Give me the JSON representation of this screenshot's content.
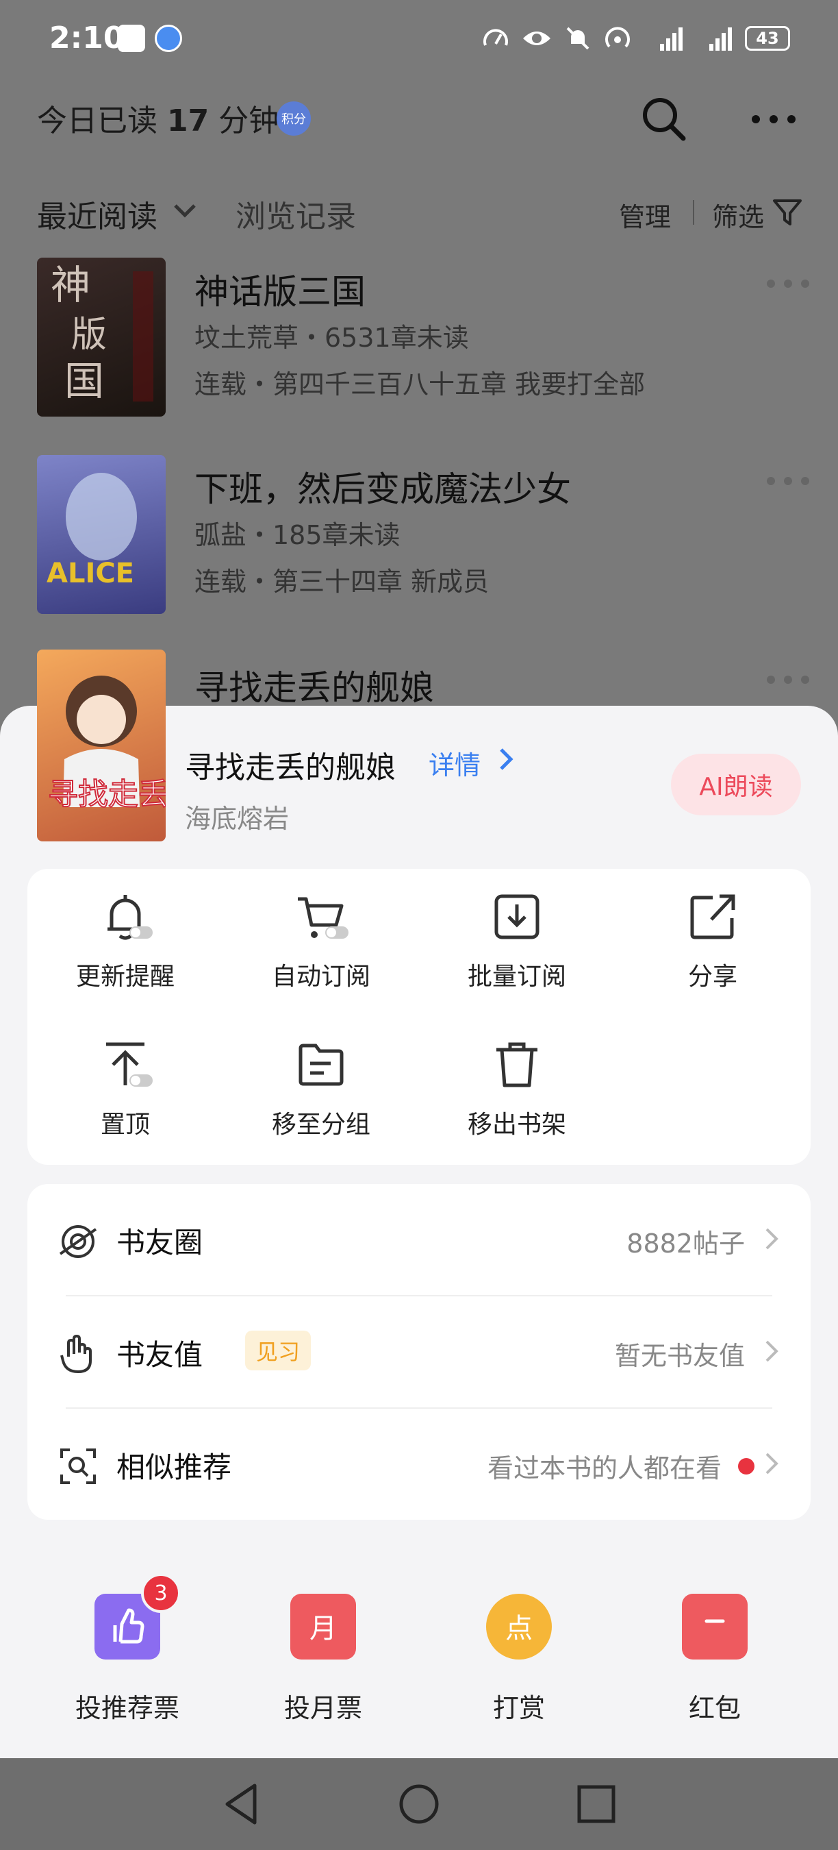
{
  "status_bar": {
    "time": "2:10",
    "battery": "43"
  },
  "header": {
    "today_read_prefix": "今日已读",
    "today_read_minutes": "17",
    "today_read_suffix": "分钟",
    "points_badge": "积分"
  },
  "tabs": {
    "recent": "最近阅读",
    "history": "浏览记录",
    "manage": "管理",
    "filter": "筛选"
  },
  "books": [
    {
      "title": "神话版三国",
      "meta": "坟土荒草・6531章未读",
      "latest": "连载・第四千三百八十五章 我要打全部"
    },
    {
      "title": "下班，然后变成魔法少女",
      "meta": "弧盐・185章未读",
      "latest": "连载・第三十四章 新成员"
    },
    {
      "title": "寻找走丢的舰娘"
    }
  ],
  "sheet": {
    "title": "寻找走丢的舰娘",
    "detail": "详情",
    "author": "海底熔岩",
    "ai_read": "AI朗读",
    "actions": [
      {
        "label": "更新提醒",
        "icon": "bell-toggle-icon"
      },
      {
        "label": "自动订阅",
        "icon": "cart-toggle-icon"
      },
      {
        "label": "批量订阅",
        "icon": "download-icon"
      },
      {
        "label": "分享",
        "icon": "share-icon"
      },
      {
        "label": "置顶",
        "icon": "pin-top-icon"
      },
      {
        "label": "移至分组",
        "icon": "folder-icon"
      },
      {
        "label": "移出书架",
        "icon": "trash-icon"
      }
    ],
    "info": {
      "circle": {
        "label": "书友圈",
        "value": "8882帖子"
      },
      "fan_value": {
        "label": "书友值",
        "badge": "见习",
        "value": "暂无书友值"
      },
      "similar": {
        "label": "相似推荐",
        "value": "看过本书的人都在看"
      }
    },
    "bottom": [
      {
        "label": "投推荐票",
        "badge": "3",
        "color": "#8b6cf0"
      },
      {
        "label": "投月票",
        "color": "#ee5a5f"
      },
      {
        "label": "打赏",
        "color": "#f6b638"
      },
      {
        "label": "红包",
        "color": "#ee5a5f"
      }
    ]
  },
  "colors": {
    "accent_blue": "#3a7ff0",
    "accent_red": "#ec4a5b"
  }
}
